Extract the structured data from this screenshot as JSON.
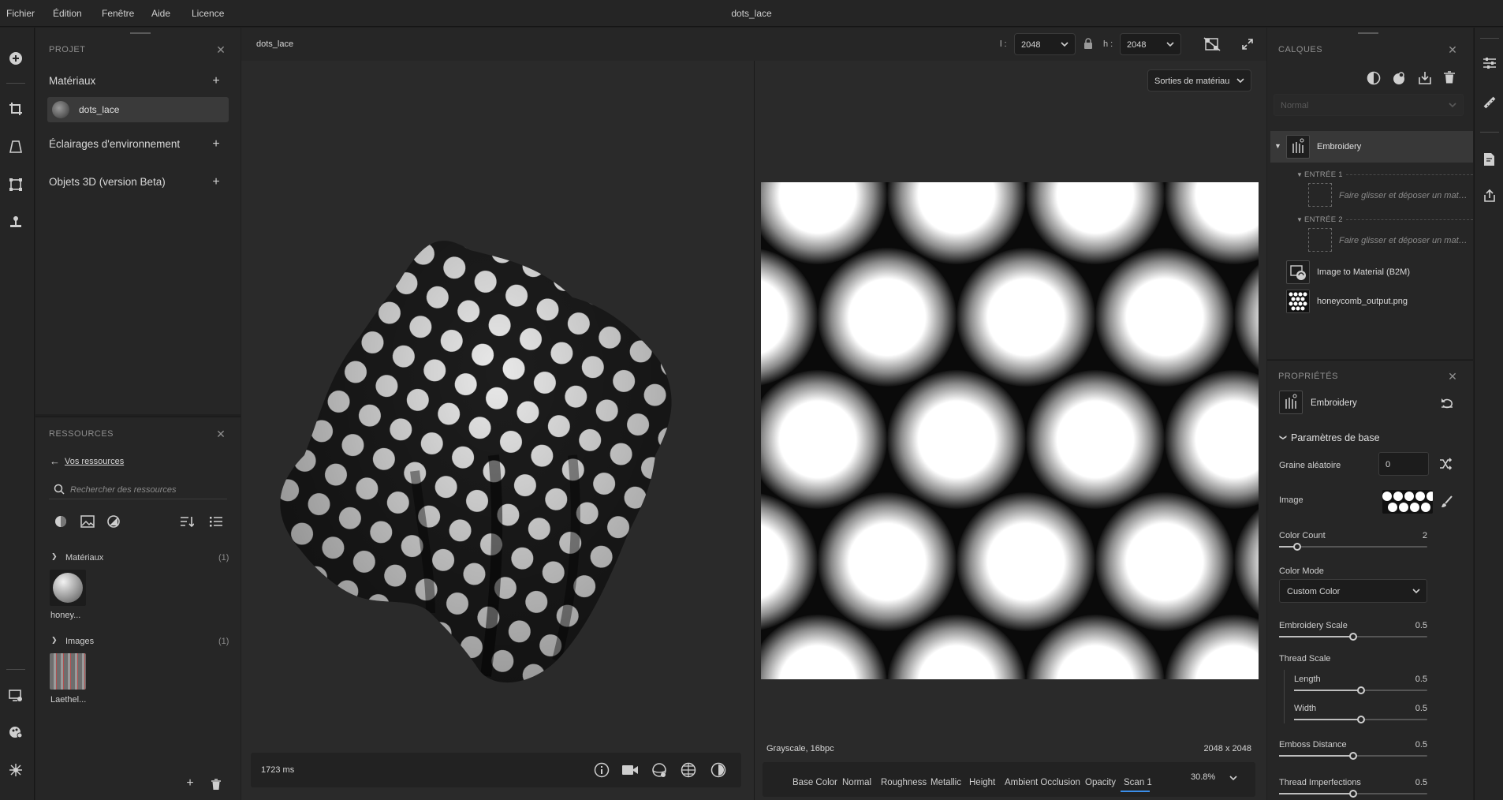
{
  "menu": {
    "items": [
      "Fichier",
      "Édition",
      "Fenêtre",
      "Aide",
      "Licence"
    ],
    "title": "dots_lace"
  },
  "project": {
    "title": "PROJET",
    "materials_label": "Matériaux",
    "material_item": "dots_lace",
    "env_label": "Éclairages d'environnement",
    "objects_label": "Objets 3D (version Beta)"
  },
  "resources": {
    "title": "RESSOURCES",
    "back_link": "Vos ressources",
    "search_placeholder": "Rechercher des ressources",
    "materials_group": "Matériaux",
    "materials_count": "(1)",
    "material_thumb_label": "honey...",
    "images_group": "Images",
    "images_count": "(1)",
    "image_thumb_label": "Laethel..."
  },
  "viewport3d": {
    "tab": "dots_lace",
    "render_time": "1723 ms"
  },
  "topbar": {
    "w_label": "l :",
    "w_value": "2048",
    "h_label": "h :",
    "h_value": "2048"
  },
  "viewport2d": {
    "outputs_dropdown": "Sorties de matériau",
    "info_left": "Grayscale, 16bpc",
    "info_right": "2048 x 2048",
    "channels": [
      "Base Color",
      "Normal",
      "Roughness",
      "Metallic",
      "Height",
      "Ambient Occlusion",
      "Opacity",
      "Scan 1"
    ],
    "active_channel": "Scan 1",
    "zoom": "30.8%"
  },
  "layers": {
    "title": "CALQUES",
    "blend_mode": "Normal",
    "items": {
      "embroidery": "Embroidery",
      "entree1": "ENTRÉE 1",
      "entree2": "ENTRÉE 2",
      "drop_hint": "Faire glisser et déposer un matériau",
      "b2m": "Image to Material (B2M)",
      "honeycomb": "honeycomb_output.png"
    }
  },
  "properties": {
    "title": "PROPRIÉTÉS",
    "layer_name": "Embroidery",
    "section": "Paramètres de base",
    "seed_label": "Graine aléatoire",
    "seed_value": "0",
    "image_label": "Image",
    "color_count": {
      "label": "Color Count",
      "value": "2",
      "fraction": 0.12
    },
    "color_mode": {
      "label": "Color Mode",
      "value": "Custom Color"
    },
    "embroidery_scale": {
      "label": "Embroidery Scale",
      "value": "0.5",
      "fraction": 0.5
    },
    "thread_scale_label": "Thread Scale",
    "length": {
      "label": "Length",
      "value": "0.5",
      "fraction": 0.5
    },
    "width": {
      "label": "Width",
      "value": "0.5",
      "fraction": 0.5
    },
    "emboss_distance": {
      "label": "Emboss Distance",
      "value": "0.5",
      "fraction": 0.5
    },
    "thread_imperfections": {
      "label": "Thread Imperfections",
      "value": "0.5",
      "fraction": 0.5
    }
  },
  "icons": [
    "add-circle-icon",
    "crop-icon",
    "perspective-icon",
    "transform-icon",
    "stamp-icon",
    "screen-settings-icon",
    "color-picker-icon",
    "network-icon",
    "sliders-icon",
    "pen-ruler-icon",
    "doc-edit-icon",
    "share-icon"
  ]
}
